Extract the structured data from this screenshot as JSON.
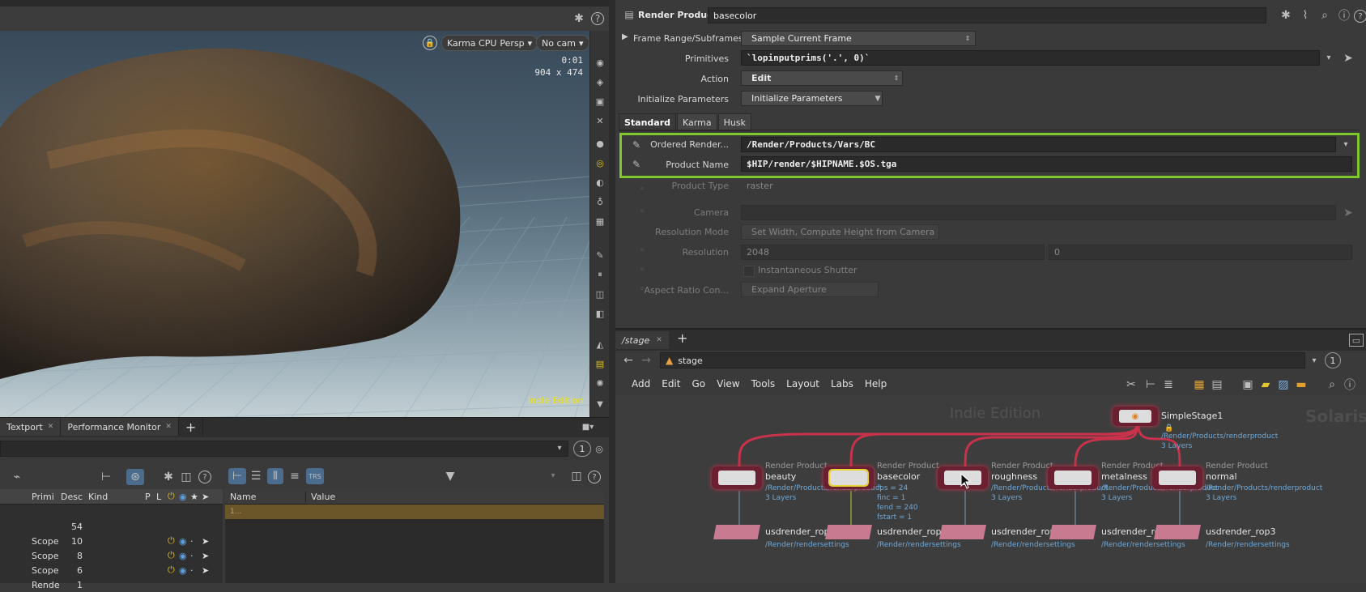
{
  "viewport": {
    "renderer": "Karma CPU",
    "camera_mode": "Persp",
    "camera": "No cam",
    "frame_time": "0:01",
    "resolution": "904 x 474",
    "watermark": "Indie Edition"
  },
  "bottom_left": {
    "tabs": [
      "Textport",
      "Performance Monitor"
    ],
    "counter": "1",
    "scene_columns": [
      "Primi",
      "Desc",
      "Kind",
      "P",
      "L"
    ],
    "scene_rows": [
      {
        "primi": "",
        "desc": "54",
        "kind": ""
      },
      {
        "primi": "Scope",
        "desc": "10",
        "kind": ""
      },
      {
        "primi": "Scope",
        "desc": "8",
        "kind": ""
      },
      {
        "primi": "Scope",
        "desc": "6",
        "kind": ""
      },
      {
        "primi": "Rende",
        "desc": "1",
        "kind": ""
      }
    ],
    "attr_columns": [
      "Name",
      "Value"
    ],
    "attr_filter_row": "1..."
  },
  "parm_editor": {
    "node_type": "Render Product",
    "node_name": "basecolor",
    "frame_range_label": "Frame Range/Subframes",
    "frame_range_value": "Sample Current Frame",
    "primitives_label": "Primitives",
    "primitives_value": "`lopinputprims('.', 0)`",
    "action_label": "Action",
    "action_value": "Edit",
    "init_label": "Initialize Parameters",
    "init_value": "Initialize Parameters",
    "tabs": [
      "Standard",
      "Karma",
      "Husk"
    ],
    "ordered_label": "Ordered Render...",
    "ordered_value": "/Render/Products/Vars/BC",
    "product_name_label": "Product Name",
    "product_name_value": "$HIP/render/$HIPNAME.$OS.tga",
    "product_type_label": "Product Type",
    "product_type_value": "raster",
    "camera_label": "Camera",
    "resolution_mode_label": "Resolution Mode",
    "resolution_mode_value": "Set Width, Compute Height from Camera",
    "resolution_label": "Resolution",
    "resolution_w": "2048",
    "resolution_h": "0",
    "shutter_label": "Instantaneous Shutter",
    "aspect_label": "Aspect Ratio Con...",
    "aspect_value": "Expand Aperture",
    "highlight_color": "#7ec82a"
  },
  "network": {
    "tab": "/stage",
    "path": "stage",
    "counter": "1",
    "menus": [
      "Add",
      "Edit",
      "Go",
      "View",
      "Tools",
      "Layout",
      "Labs",
      "Help"
    ],
    "watermark_left": "Indie Edition",
    "watermark_right": "Solaris",
    "root": {
      "name": "SimpleStage1",
      "info1": "/Render/Products/renderproduct",
      "info2": "3 Layers"
    },
    "products": [
      {
        "type": "Render Product",
        "name": "beauty",
        "info1": "/Render/Products/renderproduct",
        "info2": "3 Layers"
      },
      {
        "type": "Render Product",
        "name": "basecolor",
        "info1": "fps = 24",
        "info2": "finc = 1",
        "info3": "fend = 240",
        "info4": "fstart = 1"
      },
      {
        "type": "Render Product",
        "name": "roughness",
        "info1": "/Render/Products/renderproduct",
        "info2": "3 Layers"
      },
      {
        "type": "Render Product",
        "name": "metalness",
        "info1": "/Render/Products/renderproduct",
        "info2": "3 Layers"
      },
      {
        "type": "Render Product",
        "name": "normal",
        "info1": "/Render/Products/renderproduct",
        "info2": "3 Layers"
      }
    ],
    "rops": [
      {
        "name": "usdrender_rop2",
        "info": "/Render/rendersettings"
      },
      {
        "name": "usdrender_rop6",
        "info": "/Render/rendersettings"
      },
      {
        "name": "usdrender_rop4",
        "info": "/Render/rendersettings"
      },
      {
        "name": "usdrender_rop5",
        "info": "/Render/rendersettings"
      },
      {
        "name": "usdrender_rop3",
        "info": "/Render/rendersettings"
      }
    ],
    "link_color": "#c8324a",
    "selected_color": "#e8d234"
  }
}
